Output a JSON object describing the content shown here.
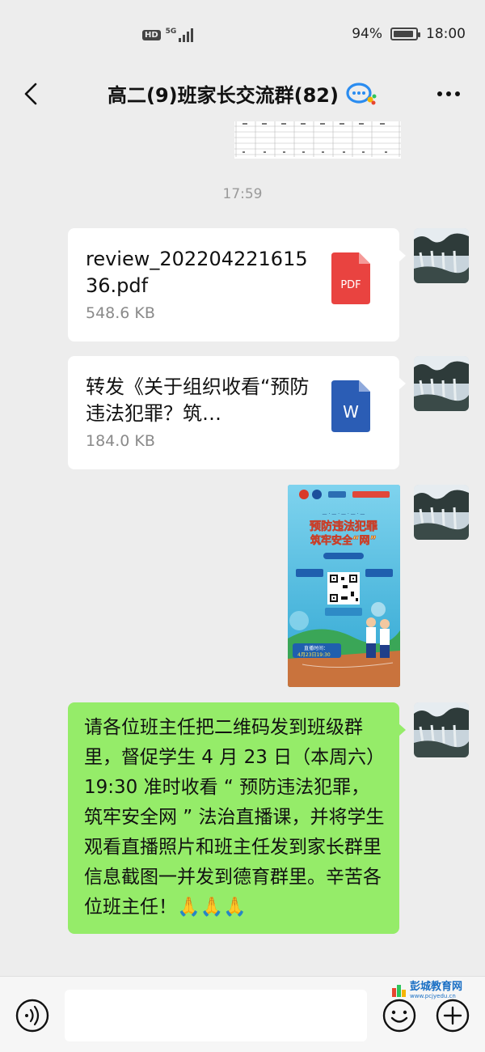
{
  "status_bar": {
    "hd": "HD",
    "network": "5G",
    "battery_text": "94%",
    "battery_level": 0.94,
    "time": "18:00"
  },
  "navbar": {
    "title": "高二(9)班家长交流群(82)",
    "back_icon": "chevron-left-icon",
    "more_icon": "more-dots-icon",
    "group_icon": "chat-group-icon"
  },
  "chat": {
    "timestamp": "17:59",
    "messages": [
      {
        "type": "file",
        "name": "review_20220422161536.pdf",
        "size": "548.6 KB",
        "icon": "pdf-icon",
        "icon_label": "PDF",
        "icon_color": "#e94340"
      },
      {
        "type": "file",
        "name": "转发《关于组织收看“预防违法犯罪？筑…",
        "size": "184.0 KB",
        "icon": "word-icon",
        "icon_label": "W",
        "icon_color": "#2b5db5"
      },
      {
        "type": "image",
        "title": "预防违法犯罪",
        "subtitle": "筑牢安全“网”",
        "live_label": "直播时间：",
        "live_time": "4月23日19:30"
      },
      {
        "type": "text",
        "text": "请各位班主任把二维码发到班级群里，督促学生 4 月 23 日（本周六）19:30 准时收看 “ 预防违法犯罪，筑牢安全网 ” 法治直播课，并将学生观看直播照片和班主任发到家长群里信息截图一并发到德育群里。辛苦各位班主任！🙏🙏🙏"
      }
    ]
  },
  "input_bar": {
    "voice_icon": "voice-icon",
    "emoji_icon": "emoji-icon",
    "plus_icon": "plus-icon",
    "input_value": ""
  },
  "watermark": {
    "text": "彭城教育网",
    "url": "www.pcjyedu.cn"
  },
  "colors": {
    "background": "#ededed",
    "bubble_green": "#95ec69",
    "pdf_red": "#e94340",
    "word_blue": "#2b5db5"
  }
}
